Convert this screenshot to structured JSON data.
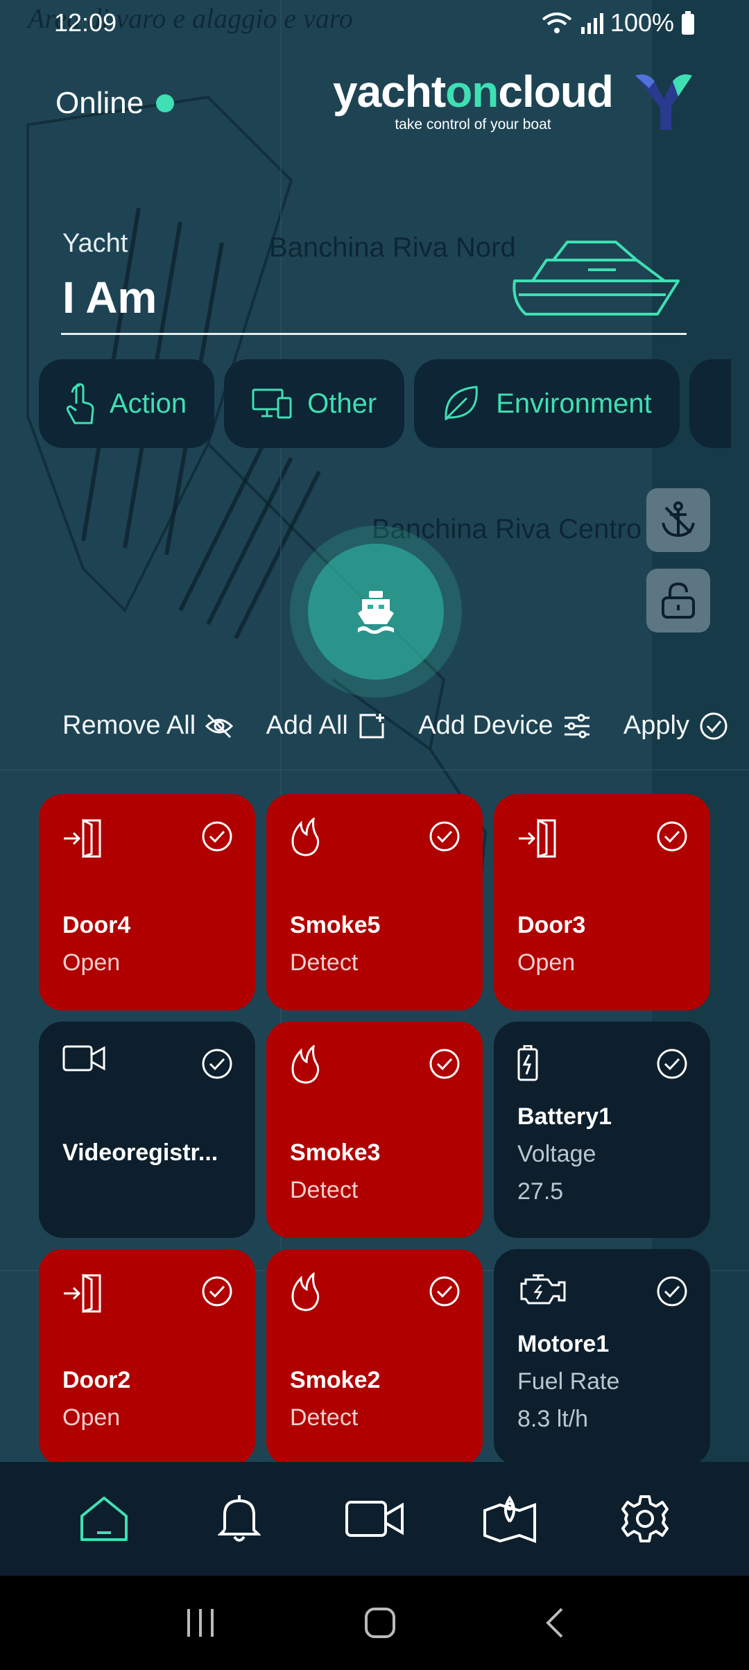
{
  "status_bar": {
    "time": "12:09",
    "battery": "100%"
  },
  "header": {
    "online_label": "Online",
    "brand_prefix": "yacht",
    "brand_accent": "on",
    "brand_suffix": "cloud",
    "tagline": "take control of your boat"
  },
  "yacht": {
    "label": "Yacht",
    "name": "I Am"
  },
  "categories": [
    {
      "label": "Action",
      "icon": "touch-icon"
    },
    {
      "label": "Other",
      "icon": "devices-icon"
    },
    {
      "label": "Environment",
      "icon": "leaf-icon"
    }
  ],
  "actions": {
    "remove_all": "Remove All",
    "add_all": "Add All",
    "add_device": "Add Device",
    "apply": "Apply"
  },
  "devices": [
    {
      "name": "Door4",
      "lines": [
        "Open"
      ],
      "status": "alarm",
      "icon": "door-icon"
    },
    {
      "name": "Smoke5",
      "lines": [
        "Detect"
      ],
      "status": "alarm",
      "icon": "flame-icon"
    },
    {
      "name": "Door3",
      "lines": [
        "Open"
      ],
      "status": "alarm",
      "icon": "door-icon"
    },
    {
      "name": "Videoregistr...",
      "lines": [],
      "status": "normal",
      "icon": "video-icon"
    },
    {
      "name": "Smoke3",
      "lines": [
        "Detect"
      ],
      "status": "alarm",
      "icon": "flame-icon"
    },
    {
      "name": "Battery1",
      "lines": [
        "Voltage",
        "27.5"
      ],
      "status": "normal",
      "icon": "battery-icon"
    },
    {
      "name": "Door2",
      "lines": [
        "Open"
      ],
      "status": "alarm",
      "icon": "door-icon"
    },
    {
      "name": "Smoke2",
      "lines": [
        "Detect"
      ],
      "status": "alarm",
      "icon": "flame-icon"
    },
    {
      "name": "Motore1",
      "lines": [
        "Fuel Rate",
        "8.3 lt/h"
      ],
      "status": "normal",
      "icon": "engine-icon"
    }
  ],
  "bottom_nav": [
    "home-icon",
    "bell-icon",
    "camera-icon",
    "map-icon",
    "settings-icon"
  ],
  "colors": {
    "accent": "#3ee0b3",
    "alarm": "#b00000",
    "card_dark": "#0d1f2d",
    "map_bg": "#1e4454"
  }
}
